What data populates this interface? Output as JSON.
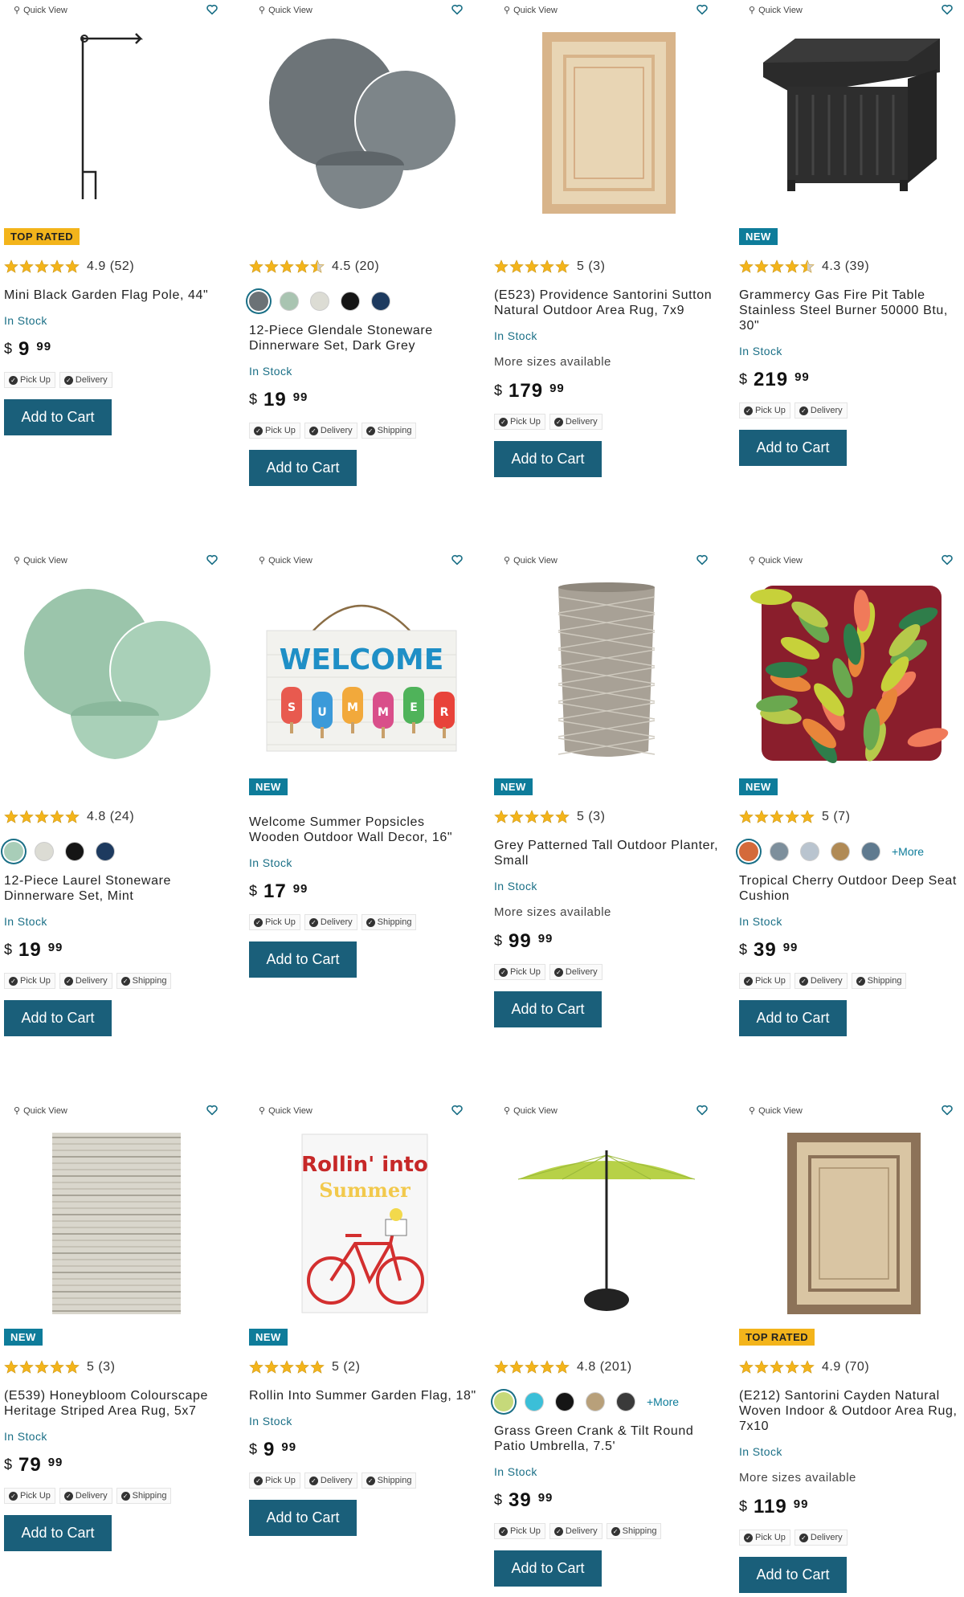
{
  "quick_view_label": "Quick View",
  "add_to_cart_label": "Add to Cart",
  "colors": {
    "accent": "#1a5f7a",
    "stock": "#1a6f86",
    "badge_new": "#0e7c9a",
    "badge_top": "#f3b41b",
    "star": "#f3b41b"
  },
  "products": [
    {
      "badge": "TOP RATED",
      "badge_type": "top",
      "stars": 5,
      "rating": "4.9 (52)",
      "swatches": [],
      "more": "",
      "title": "Mini Black Garden Flag Pole, 44\"",
      "stock": "In Stock",
      "sizes": "",
      "price_dollars": "9",
      "price_cents": "99",
      "chips": [
        "Pick Up",
        "Delivery"
      ],
      "image": "flag-pole"
    },
    {
      "badge": "",
      "badge_type": "",
      "stars": 4.5,
      "rating": "4.5 (20)",
      "swatches": [
        "#6b7276",
        "#a9c4b1",
        "#dcdcd4",
        "#151515",
        "#1d3a5f"
      ],
      "more": "",
      "title": "12-Piece Glendale Stoneware Dinnerware Set, Dark Grey",
      "stock": "In Stock",
      "sizes": "",
      "price_dollars": "19",
      "price_cents": "99",
      "chips": [
        "Pick Up",
        "Delivery",
        "Shipping"
      ],
      "image": "dishes-grey"
    },
    {
      "badge": "",
      "badge_type": "",
      "stars": 5,
      "rating": "5 (3)",
      "swatches": [],
      "more": "",
      "title": "(E523) Providence Santorini Sutton Natural Outdoor Area Rug, 7x9",
      "stock": "In Stock",
      "sizes": "More sizes available",
      "price_dollars": "179",
      "price_cents": "99",
      "chips": [
        "Pick Up",
        "Delivery"
      ],
      "image": "rug-natural"
    },
    {
      "badge": "NEW",
      "badge_type": "new",
      "stars": 4.5,
      "rating": "4.3 (39)",
      "swatches": [],
      "more": "",
      "title": "Grammercy Gas Fire Pit Table Stainless Steel Burner 50000 Btu, 30\"",
      "stock": "In Stock",
      "sizes": "",
      "price_dollars": "219",
      "price_cents": "99",
      "chips": [
        "Pick Up",
        "Delivery"
      ],
      "image": "fire-pit"
    },
    {
      "badge": "",
      "badge_type": "",
      "stars": 5,
      "rating": "4.8 (24)",
      "swatches": [
        "#a8cdb8",
        "#dcdcd4",
        "#151515",
        "#1d3a5f"
      ],
      "more": "",
      "title": "12-Piece Laurel Stoneware Dinnerware Set, Mint",
      "stock": "In Stock",
      "sizes": "",
      "price_dollars": "19",
      "price_cents": "99",
      "chips": [
        "Pick Up",
        "Delivery",
        "Shipping"
      ],
      "image": "dishes-mint"
    },
    {
      "badge": "NEW",
      "badge_type": "new",
      "stars": 0,
      "rating": "",
      "swatches": [],
      "more": "",
      "title": "Welcome Summer Popsicles Wooden Outdoor Wall Decor, 16\"",
      "stock": "In Stock",
      "sizes": "",
      "price_dollars": "17",
      "price_cents": "99",
      "chips": [
        "Pick Up",
        "Delivery",
        "Shipping"
      ],
      "image": "welcome-sign",
      "image_text": "WELCOME",
      "image_letters": "SUMMER"
    },
    {
      "badge": "NEW",
      "badge_type": "new",
      "stars": 5,
      "rating": "5 (3)",
      "swatches": [],
      "more": "",
      "title": "Grey Patterned Tall Outdoor Planter, Small",
      "stock": "In Stock",
      "sizes": "More sizes available",
      "price_dollars": "99",
      "price_cents": "99",
      "chips": [
        "Pick Up",
        "Delivery"
      ],
      "image": "planter"
    },
    {
      "badge": "NEW",
      "badge_type": "new",
      "stars": 5,
      "rating": "5 (7)",
      "swatches": [
        "#d46a3a",
        "#7d8f9c",
        "#b9c4cf",
        "#b08a55",
        "#5f7a8f"
      ],
      "more": "+More",
      "title": "Tropical Cherry Outdoor Deep Seat Cushion",
      "stock": "In Stock",
      "sizes": "",
      "price_dollars": "39",
      "price_cents": "99",
      "chips": [
        "Pick Up",
        "Delivery",
        "Shipping"
      ],
      "image": "cushion"
    },
    {
      "badge": "NEW",
      "badge_type": "new",
      "stars": 5,
      "rating": "5 (3)",
      "swatches": [],
      "more": "",
      "title": "(E539) Honeybloom Colourscape Heritage Striped Area Rug, 5x7",
      "stock": "In Stock",
      "sizes": "",
      "price_dollars": "79",
      "price_cents": "99",
      "chips": [
        "Pick Up",
        "Delivery",
        "Shipping"
      ],
      "image": "rug-striped"
    },
    {
      "badge": "NEW",
      "badge_type": "new",
      "stars": 5,
      "rating": "5 (2)",
      "swatches": [],
      "more": "",
      "title": "Rollin Into Summer Garden Flag, 18\"",
      "stock": "In Stock",
      "sizes": "",
      "price_dollars": "9",
      "price_cents": "99",
      "chips": [
        "Pick Up",
        "Delivery",
        "Shipping"
      ],
      "image": "garden-flag",
      "image_text": "Rollin' into",
      "image_text2": "Summer"
    },
    {
      "badge": "",
      "badge_type": "",
      "stars": 5,
      "rating": "4.8 (201)",
      "swatches": [
        "#c6d97a",
        "#3bbfd8",
        "#151515",
        "#b8a07a",
        "#3a3a3a"
      ],
      "more": "+More",
      "title": "Grass Green Crank & Tilt Round Patio Umbrella, 7.5'",
      "stock": "In Stock",
      "sizes": "",
      "price_dollars": "39",
      "price_cents": "99",
      "chips": [
        "Pick Up",
        "Delivery",
        "Shipping"
      ],
      "image": "umbrella"
    },
    {
      "badge": "TOP RATED",
      "badge_type": "top",
      "stars": 5,
      "rating": "4.9 (70)",
      "swatches": [],
      "more": "",
      "title": "(E212) Santorini Cayden Natural Woven Indoor & Outdoor Area Rug, 7x10",
      "stock": "In Stock",
      "sizes": "More sizes available",
      "price_dollars": "119",
      "price_cents": "99",
      "chips": [
        "Pick Up",
        "Delivery"
      ],
      "image": "rug-cayden"
    }
  ]
}
